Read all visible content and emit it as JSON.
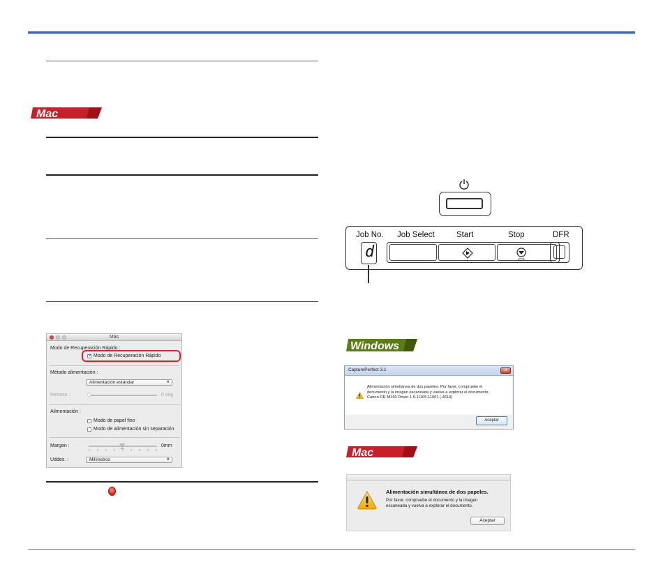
{
  "banners": {
    "mac_top": "Mac",
    "windows": "Windows",
    "mac_bottom": "Mac"
  },
  "mac_options_dialog": {
    "title": "Más",
    "section_recovery_label": "Modo de Recuperación Rápido :",
    "rapid_recovery_checkbox": "Modo de Recuperación Rápido",
    "rapid_recovery_checked": true,
    "feed_method_label": "Método alimentación :",
    "feed_method_value": "Alimentación estándar",
    "delay_label": "Retraso :",
    "delay_value": "0 seg",
    "feeding_label": "Alimentación :",
    "thin_paper_checkbox": "Modo de papel fino",
    "thin_paper_checked": false,
    "no_separation_checkbox": "Modo de alimentación sin separación",
    "no_separation_checked": false,
    "margin_label": "Margen :",
    "margin_value": "0mm",
    "units_label": "Uddes. :",
    "units_value": "Milímetros"
  },
  "scanner_panel": {
    "job_no_label": "Job No.",
    "job_no_display": "d",
    "job_select_label": "Job Select",
    "start_label": "Start",
    "stop_label": "Stop",
    "dfr_label": "DFR"
  },
  "windows_dialog": {
    "title": "CapturePerfect 3.1",
    "close_glyph": "✕",
    "line1": "Alimentación simultánea de dos papeles. Por favor, compruebe el",
    "line2": "documento y la imagen escaneada y vuelva a explorar el documento.",
    "line3": "Canon DR-M160 Driver 1.0.11105.11001 (-4619)",
    "ok_button": "Aceptar"
  },
  "mac_alert": {
    "heading": "Alimentación simultánea de dos papeles.",
    "line1": "Por favor, compruebe el documento y la imagen",
    "line2": "escaneada y vuelva a explorar el documento.",
    "ok_button": "Aceptar"
  },
  "colors": {
    "header_rule": "#3d62c4",
    "mac_banner": "#c8202a",
    "windows_banner": "#5a7d16",
    "highlight_box": "#e0202a"
  }
}
